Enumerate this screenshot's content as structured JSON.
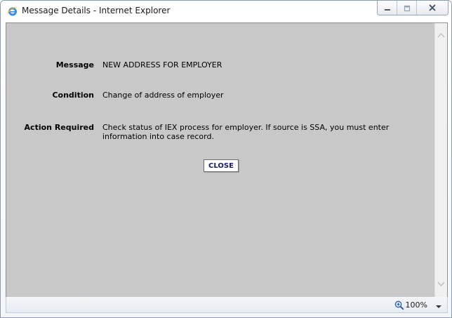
{
  "window": {
    "title": "Message Details - Internet Explorer"
  },
  "details": {
    "message_label": "Message",
    "message_value": "NEW ADDRESS FOR EMPLOYER",
    "condition_label": "Condition",
    "condition_value": "Change of address of employer",
    "action_label": "Action Required",
    "action_value": "Check status of IEX process for employer. If source is SSA, you must enter information into case record."
  },
  "buttons": {
    "close_label": "CLOSE"
  },
  "statusbar": {
    "zoom_level": "100%"
  },
  "icons": {
    "app": "internet-explorer-icon",
    "minimize": "minimize-icon",
    "maximize": "maximize-icon",
    "close": "close-icon",
    "zoom": "zoom-magnifier-icon",
    "zoom_menu": "chevron-down-icon"
  },
  "colors": {
    "content_background": "#c8c8c8",
    "close_button_text": "#1a1a6a"
  }
}
